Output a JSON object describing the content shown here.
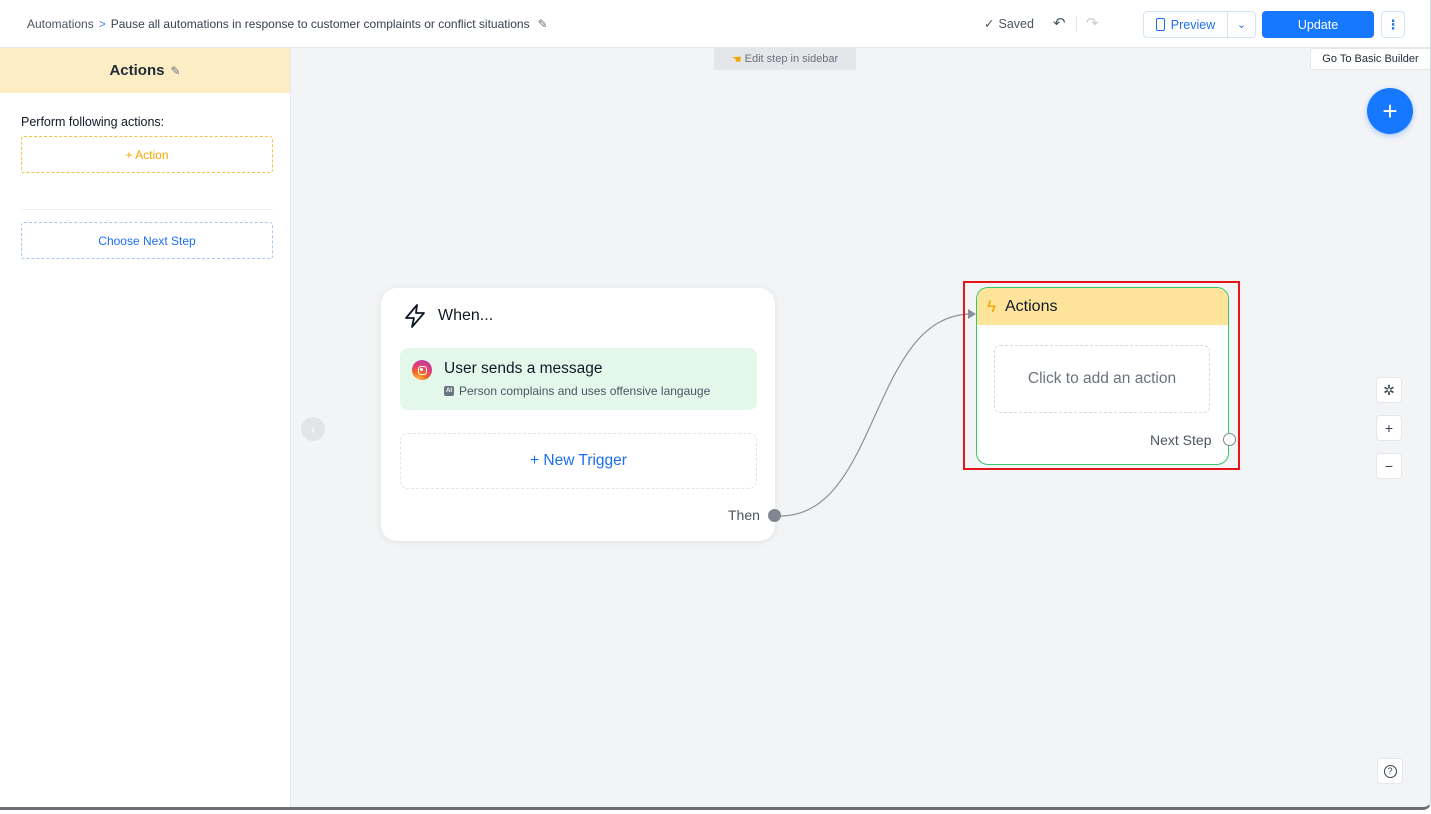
{
  "header": {
    "breadcrumb_root": "Automations",
    "breadcrumb_sep": ">",
    "automation_title": "Pause all automations in response to customer complaints or conflict situations",
    "saved_status": "Saved",
    "preview_label": "Preview",
    "update_label": "Update",
    "basic_builder_label": "Go To Basic Builder"
  },
  "sidebar": {
    "title": "Actions",
    "section_label": "Perform following actions:",
    "add_action_label": "+ Action",
    "choose_next_label": "Choose Next Step"
  },
  "canvas": {
    "hint": "Edit step in sidebar",
    "when_node": {
      "title": "When...",
      "trigger_title": "User sends a message",
      "trigger_badge": "AI",
      "trigger_condition": "Person complains and uses offensive langauge",
      "new_trigger_label": "+ New Trigger",
      "then_label": "Then"
    },
    "actions_node": {
      "title": "Actions",
      "placeholder": "Click to add an action",
      "next_label": "Next Step"
    }
  },
  "colors": {
    "primary": "#1677ff",
    "sidebar_header_bg": "#fdedc4",
    "actions_header_bg": "#fde49a",
    "action_accent": "#f0a800",
    "trigger_bg": "#e3f8ea",
    "node_border_success": "#34c76c",
    "highlight_box": "#e5161b"
  },
  "icons": {
    "breadcrumb_edit": "pencil-icon",
    "saved": "check-icon",
    "undo": "undo-icon",
    "redo": "redo-icon",
    "preview": "phone-icon",
    "more": "more-vertical-icon",
    "add": "plus-icon",
    "trigger": "lightning-icon",
    "channel": "instagram-icon",
    "magic": "magic-wand-icon",
    "zoom_in": "plus-icon",
    "zoom_out": "minus-icon",
    "help": "help-icon",
    "collapse": "chevron-left-icon"
  }
}
